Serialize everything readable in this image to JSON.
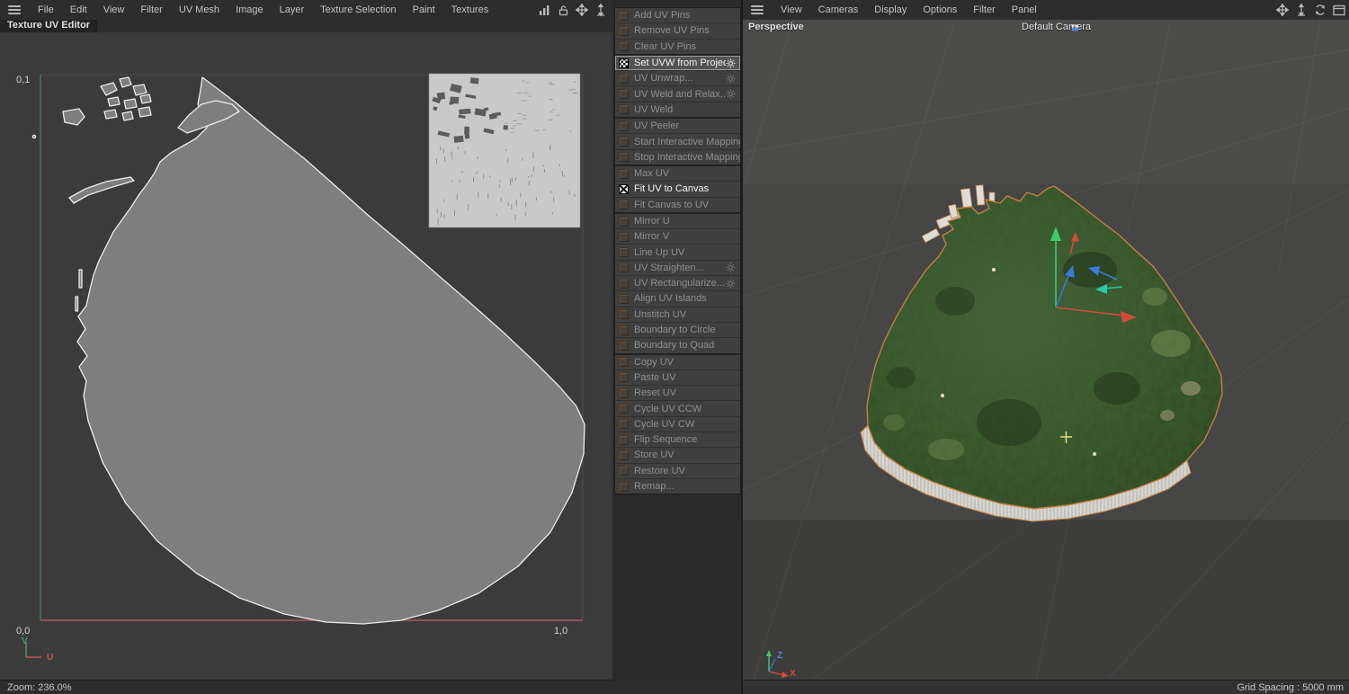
{
  "left_pane": {
    "menu": [
      "File",
      "Edit",
      "View",
      "Filter",
      "UV Mesh",
      "Image",
      "Layer",
      "Texture Selection",
      "Paint",
      "Textures"
    ],
    "menubar_icons": [
      "chart-icon",
      "lock-icon",
      "move-icon",
      "dolly-icon"
    ],
    "tab": "Texture UV Editor",
    "labels": {
      "top_left": "0,1",
      "origin": "0,0",
      "bottom_right": "1,0",
      "axis_u": "U",
      "axis_v": "V"
    },
    "status": "Zoom: 236.0%"
  },
  "palette": {
    "groups": [
      [
        {
          "label": "Add UV Pins",
          "icon": "add-uv-pins-icon",
          "enabled": false,
          "gear": false,
          "highlight": false
        },
        {
          "label": "Remove UV Pins",
          "icon": "remove-uv-pins-icon",
          "enabled": false,
          "gear": false,
          "highlight": false
        },
        {
          "label": "Clear UV Pins",
          "icon": "clear-uv-pins-icon",
          "enabled": false,
          "gear": false,
          "highlight": false
        }
      ],
      [
        {
          "label": "Set UVW from Projection...",
          "icon": "set-uvw-projection-icon",
          "enabled": true,
          "gear": true,
          "highlight": true
        },
        {
          "label": "UV Unwrap...",
          "icon": "uv-unwrap-icon",
          "enabled": false,
          "gear": true,
          "highlight": false
        },
        {
          "label": "UV Weld and Relax...",
          "icon": "uv-weld-relax-icon",
          "enabled": false,
          "gear": true,
          "highlight": false
        },
        {
          "label": "UV Weld",
          "icon": "uv-weld-icon",
          "enabled": false,
          "gear": false,
          "highlight": false
        }
      ],
      [
        {
          "label": "UV Peeler",
          "icon": "uv-peeler-icon",
          "enabled": false,
          "gear": false,
          "highlight": false
        },
        {
          "label": "Start Interactive Mapping",
          "icon": "start-interactive-mapping-icon",
          "enabled": false,
          "gear": false,
          "highlight": false
        },
        {
          "label": "Stop Interactive Mapping",
          "icon": "stop-interactive-mapping-icon",
          "enabled": false,
          "gear": false,
          "highlight": false
        }
      ],
      [
        {
          "label": "Max UV",
          "icon": "max-uv-icon",
          "enabled": false,
          "gear": false,
          "highlight": false
        },
        {
          "label": "Fit UV to Canvas",
          "icon": "fit-uv-to-canvas-icon",
          "enabled": true,
          "gear": false,
          "highlight": false
        },
        {
          "label": "Fit Canvas to UV",
          "icon": "fit-canvas-to-uv-icon",
          "enabled": false,
          "gear": false,
          "highlight": false
        }
      ],
      [
        {
          "label": "Mirror U",
          "icon": "mirror-u-icon",
          "enabled": false,
          "gear": false,
          "highlight": false
        },
        {
          "label": "Mirror V",
          "icon": "mirror-v-icon",
          "enabled": false,
          "gear": false,
          "highlight": false
        },
        {
          "label": "Line Up UV",
          "icon": "line-up-uv-icon",
          "enabled": false,
          "gear": false,
          "highlight": false
        },
        {
          "label": "UV Straighten...",
          "icon": "uv-straighten-icon",
          "enabled": false,
          "gear": true,
          "highlight": false
        },
        {
          "label": "UV Rectangularize...",
          "icon": "uv-rectangularize-icon",
          "enabled": false,
          "gear": true,
          "highlight": false
        },
        {
          "label": "Align UV Islands",
          "icon": "align-uv-islands-icon",
          "enabled": false,
          "gear": false,
          "highlight": false
        },
        {
          "label": "Unstitch UV",
          "icon": "unstitch-uv-icon",
          "enabled": false,
          "gear": false,
          "highlight": false
        },
        {
          "label": "Boundary to Circle",
          "icon": "boundary-to-circle-icon",
          "enabled": false,
          "gear": false,
          "highlight": false
        },
        {
          "label": "Boundary to Quad",
          "icon": "boundary-to-quad-icon",
          "enabled": false,
          "gear": false,
          "highlight": false
        }
      ],
      [
        {
          "label": "Copy UV",
          "icon": "copy-uv-icon",
          "enabled": false,
          "gear": false,
          "highlight": false
        },
        {
          "label": "Paste UV",
          "icon": "paste-uv-icon",
          "enabled": false,
          "gear": false,
          "highlight": false
        },
        {
          "label": "Reset UV",
          "icon": "reset-uv-icon",
          "enabled": false,
          "gear": false,
          "highlight": false
        },
        {
          "label": "Cycle UV CCW",
          "icon": "cycle-uv-ccw-icon",
          "enabled": false,
          "gear": false,
          "highlight": false
        },
        {
          "label": "Cycle UV CW",
          "icon": "cycle-uv-cw-icon",
          "enabled": false,
          "gear": false,
          "highlight": false
        },
        {
          "label": "Flip Sequence",
          "icon": "flip-sequence-icon",
          "enabled": false,
          "gear": false,
          "highlight": false
        },
        {
          "label": "Store UV",
          "icon": "store-uv-icon",
          "enabled": false,
          "gear": false,
          "highlight": false
        },
        {
          "label": "Restore UV",
          "icon": "restore-uv-icon",
          "enabled": false,
          "gear": false,
          "highlight": false
        },
        {
          "label": "Remap...",
          "icon": "remap-icon",
          "enabled": false,
          "gear": false,
          "highlight": false
        }
      ]
    ]
  },
  "right_pane": {
    "menu": [
      "View",
      "Cameras",
      "Display",
      "Options",
      "Filter",
      "Panel"
    ],
    "menubar_icons": [
      "move-icon",
      "dolly-icon",
      "rotate-icon",
      "maximize-icon"
    ],
    "view_label": "Perspective",
    "camera_label": "Default Camera",
    "axis_labels": {
      "x": "X",
      "z": "Z"
    },
    "status": "Grid Spacing : 5000 mm"
  },
  "colors": {
    "uv_axis_u": "#b05a5a",
    "uv_axis_v": "#4e8a62",
    "axis_x": "#d14b3c",
    "axis_y": "#3fca6a",
    "axis_z": "#3c78d8",
    "selection_outline": "#c08040",
    "menu_highlight": "#545454"
  }
}
